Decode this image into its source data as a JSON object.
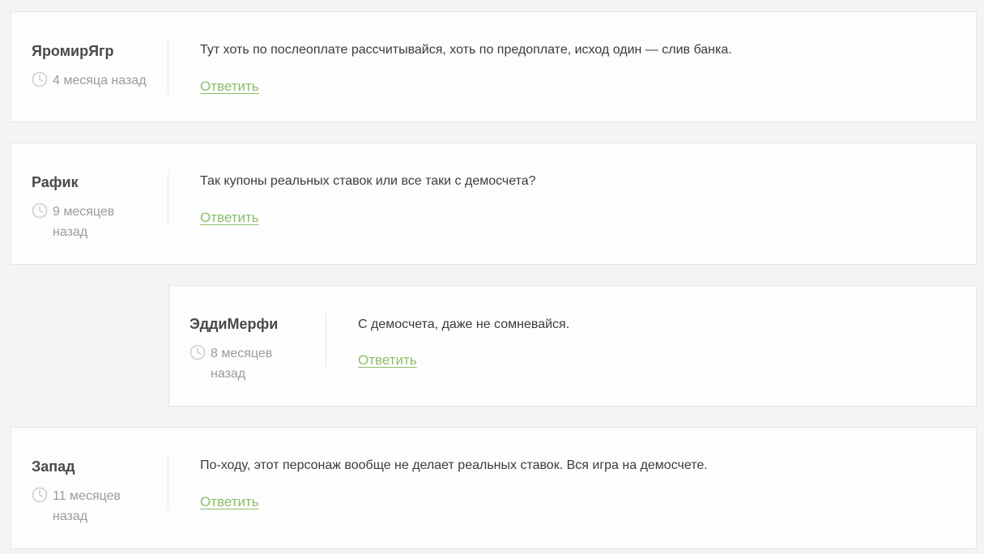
{
  "reply_label": "Ответить",
  "accent_color": "#8cbd6a",
  "comments": [
    {
      "author": "ЯромирЯгр",
      "date": "4 месяца назад",
      "text": "Тут хоть по послеоплате рассчитывайся, хоть по предоплате, исход один — слив банка."
    },
    {
      "author": "Рафик",
      "date": "9 месяцев назад",
      "text": "Так купоны реальных ставок или все таки с демосчета?"
    },
    {
      "author": "ЭддиМерфи",
      "date": "8 месяцев назад",
      "text": "С демосчета, даже не сомневайся."
    },
    {
      "author": "Запад",
      "date": "11 месяцев назад",
      "text": "По-ходу, этот персонаж вообще не делает реальных ставок. Вся игра на демосчете."
    }
  ]
}
